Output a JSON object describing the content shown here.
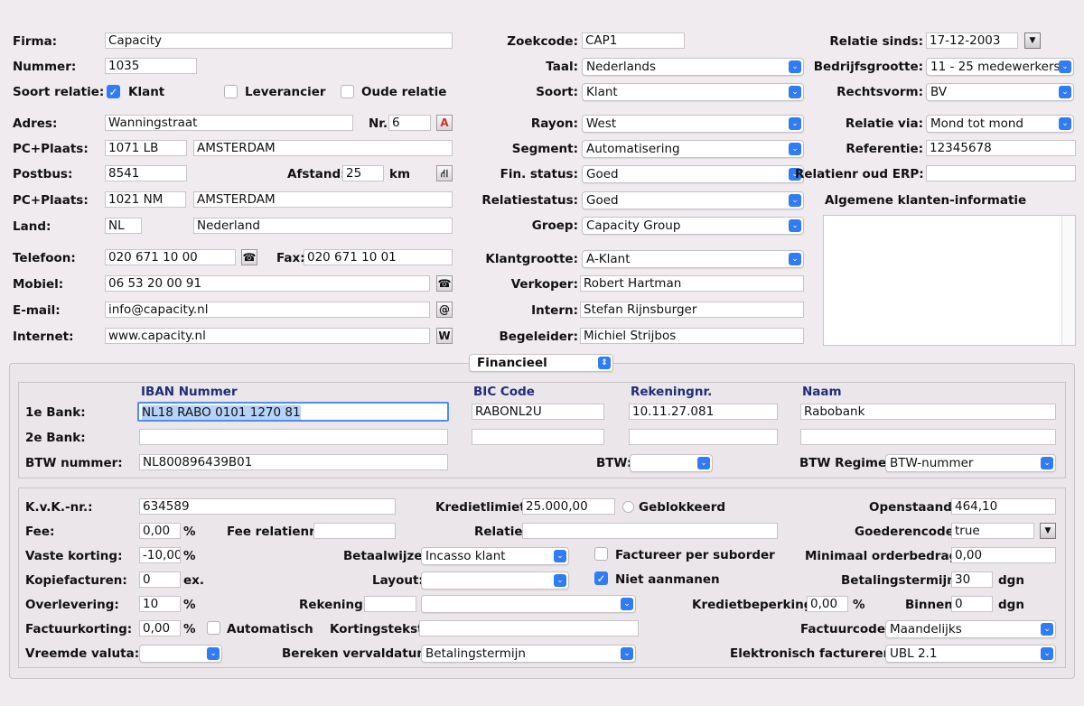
{
  "left": {
    "firma_label": "Firma:",
    "firma": "Capacity",
    "nummer_label": "Nummer:",
    "nummer": "1035",
    "soort_relatie_label": "Soort relatie:",
    "klant_label": "Klant",
    "leverancier_label": "Leverancier",
    "oude_relatie_label": "Oude relatie",
    "adres_label": "Adres:",
    "adres": "Wanningstraat",
    "nr_label": "Nr.",
    "nr": "6",
    "pcplaats_label": "PC+Plaats:",
    "pc1": "1071 LB",
    "plaats1": "AMSTERDAM",
    "postbus_label": "Postbus:",
    "postbus": "8541",
    "afstand_label": "Afstand:",
    "afstand": "25",
    "km_label": "km",
    "pcplaats2_label": "PC+Plaats:",
    "pc2": "1021 NM",
    "plaats2": "AMSTERDAM",
    "land_label": "Land:",
    "land_code": "NL",
    "land": "Nederland",
    "telefoon_label": "Telefoon:",
    "telefoon": "020 671 10 00",
    "fax_label": "Fax:",
    "fax": "020 671 10 01",
    "mobiel_label": "Mobiel:",
    "mobiel": "06 53 20 00 91",
    "email_label": "E-mail:",
    "email": "info@capacity.nl",
    "internet_label": "Internet:",
    "internet": "www.capacity.nl"
  },
  "middle": {
    "zoekcode_label": "Zoekcode:",
    "zoekcode": "CAP1",
    "taal_label": "Taal:",
    "taal": "Nederlands",
    "soort_label": "Soort:",
    "soort": "Klant",
    "rayon_label": "Rayon:",
    "rayon": "West",
    "segment_label": "Segment:",
    "segment": "Automatisering",
    "finstatus_label": "Fin. status:",
    "finstatus": "Goed",
    "relatiestatus_label": "Relatiestatus:",
    "relatiestatus": "Goed",
    "groep_label": "Groep:",
    "groep": "Capacity Group",
    "klantgrootte_label": "Klantgrootte:",
    "klantgrootte": "A-Klant",
    "verkoper_label": "Verkoper:",
    "verkoper": "Robert Hartman",
    "intern_label": "Intern:",
    "intern": "Stefan Rijnsburger",
    "begeleider_label": "Begeleider:",
    "begeleider": "Michiel Strijbos"
  },
  "right": {
    "relatie_sinds_label": "Relatie sinds:",
    "relatie_sinds": "17-12-2003",
    "bedrijfsgrootte_label": "Bedrijfsgrootte:",
    "bedrijfsgrootte": "11 - 25 medewerkers",
    "rechtsvorm_label": "Rechtsvorm:",
    "rechtsvorm": "BV",
    "relatie_via_label": "Relatie via:",
    "relatie_via": "Mond tot mond",
    "referentie_label": "Referentie:",
    "referentie": "12345678",
    "relatienr_label": "Relatienr oud ERP:",
    "relatienr": "",
    "algemene_label": "Algemene klanten-informatie"
  },
  "tab_selector": "Financieel",
  "bank": {
    "iban_hdr": "IBAN Nummer",
    "bic_hdr": "BIC Code",
    "rek_hdr": "Rekeningnr.",
    "naam_hdr": "Naam",
    "bank1_label": "1e Bank:",
    "iban1": "NL18 RABO 0101 1270 81",
    "bic1": "RABONL2U",
    "rek1": "10.11.27.081",
    "naam1": "Rabobank",
    "bank2_label": "2e Bank:",
    "btwnr_label": "BTW nummer:",
    "btwnr": "NL800896439B01",
    "btw_label": "BTW:",
    "btw": "",
    "btwregime_label": "BTW Regime:",
    "btwregime": "BTW-nummer"
  },
  "fin": {
    "kvk_label": "K.v.K.-nr.:",
    "kvk": "634589",
    "kredietlimiet_label": "Kredietlimiet:",
    "kredietlimiet": "25.000,00",
    "geblokkeerd_label": "Geblokkeerd",
    "openstaand_label": "Openstaand:",
    "openstaand": "464,10",
    "fee_label": "Fee:",
    "fee": "0,00",
    "pct": "%",
    "feerel_label": "Fee relatienr.:",
    "feerel": "",
    "relatie_label": "Relatie:",
    "relatie": "",
    "goederencode_label": "Goederencode:",
    "goederencode": "true",
    "vaste_label": "Vaste korting:",
    "vaste": "-10,00",
    "betaalwijze_label": "Betaalwijze:",
    "betaalwijze": "Incasso klant",
    "factureer_label": "Factureer per suborder",
    "minimaal_label": "Minimaal orderbedrag:",
    "minimaal": "0,00",
    "kopie_label": "Kopiefacturen:",
    "kopie": "0",
    "ex_label": "ex.",
    "layout_label": "Layout:",
    "layout": "",
    "niet_label": "Niet aanmanen",
    "betterm_label": "Betalingstermijn:",
    "betterm": "30",
    "dgn_label": "dgn",
    "overlevering_label": "Overlevering:",
    "overlevering": "10",
    "rekening_label": "Rekening:",
    "rekening": "",
    "rekening_sel": "",
    "kredietbep_label": "Kredietbeperking:",
    "kredietbep": "0,00",
    "binnen_label": "Binnen",
    "binnen": "0",
    "factuurkorting_label": "Factuurkorting:",
    "factuurkorting": "0,00",
    "automatisch_label": "Automatisch",
    "kortingstekst_label": "Kortingstekst:",
    "kortingstekst": "",
    "factuurcode_label": "Factuurcode:",
    "factuurcode": "Maandelijks",
    "vreemde_label": "Vreemde valuta:",
    "vreemde": "",
    "bereken_label": "Bereken vervaldatum:",
    "bereken": "Betalingstermijn",
    "elektronisch_label": "Elektronisch factureren:",
    "elektronisch": "UBL 2.1"
  }
}
